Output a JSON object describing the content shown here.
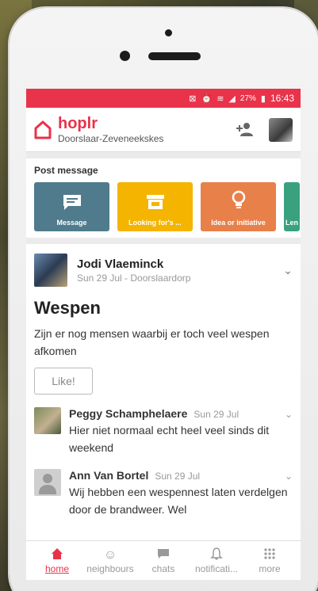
{
  "status_bar": {
    "battery": "27%",
    "time": "16:43"
  },
  "header": {
    "brand": "hoplr",
    "neighbourhood": "Doorslaar-Zeveneekskes"
  },
  "post_message": {
    "title": "Post message",
    "tiles": [
      {
        "label": "Message",
        "icon": "message-icon",
        "color": "#4f7b8d"
      },
      {
        "label": "Looking for's ...",
        "icon": "shop-icon",
        "color": "#f4b400"
      },
      {
        "label": "Idea or initiative",
        "icon": "lightbulb-icon",
        "color": "#e8804a"
      },
      {
        "label": "Len",
        "icon": "",
        "color": "#3aa17e"
      }
    ]
  },
  "post": {
    "author": "Jodi Vlaeminck",
    "meta": "Sun 29 Jul - Doorslaardorp",
    "title": "Wespen",
    "body": "Zijn er nog mensen waarbij er toch veel wespen afkomen",
    "like_label": "Like!"
  },
  "comments": [
    {
      "name": "Peggy Schamphelaere",
      "date": "Sun 29 Jul",
      "text": "Hier niet normaal echt heel veel sinds dit weekend"
    },
    {
      "name": "Ann Van Bortel",
      "date": "Sun 29 Jul",
      "text": "Wij hebben een wespennest laten verdelgen door de brandweer. Wel"
    }
  ],
  "nav": {
    "home": "home",
    "neighbours": "neighbours",
    "chats": "chats",
    "notifications": "notificati...",
    "more": "more"
  },
  "colors": {
    "accent": "#e8334a"
  }
}
